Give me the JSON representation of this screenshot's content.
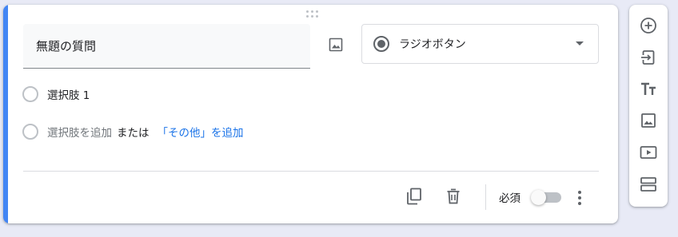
{
  "question": {
    "title": "無題の質問",
    "type_label": "ラジオボタン"
  },
  "options": {
    "option1": "選択肢 1",
    "add_option": "選択肢を追加",
    "or_text": "または",
    "add_other": "「その他」を追加"
  },
  "footer": {
    "required_label": "必須",
    "required_on": false
  },
  "colors": {
    "accent": "#4285f4",
    "link": "#1a73e8",
    "icon": "#5f6368"
  },
  "icons": {
    "side_toolbar": [
      "add-circle-icon",
      "import-icon",
      "title-icon",
      "image-icon",
      "video-icon",
      "section-icon"
    ],
    "footer": [
      "copy-icon",
      "delete-icon",
      "more-vert-icon"
    ]
  }
}
